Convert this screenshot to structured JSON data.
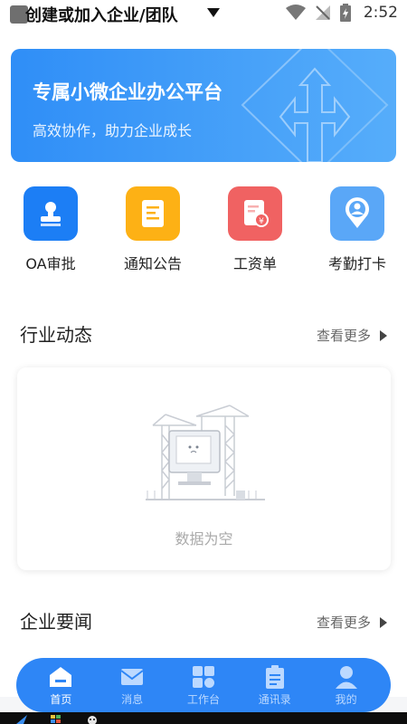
{
  "status_bar": {
    "title": "创建或加入企业/团队",
    "time": "2:52"
  },
  "banner": {
    "title": "专属小微企业办公平台",
    "subtitle": "高效协作，助力企业成长"
  },
  "quick_actions": [
    {
      "label": "OA审批",
      "icon": "stamp-icon",
      "color": "#1c7ef5"
    },
    {
      "label": "通知公告",
      "icon": "document-icon",
      "color": "#fdb115"
    },
    {
      "label": "工资单",
      "icon": "payslip-icon",
      "color": "#f06262"
    },
    {
      "label": "考勤打卡",
      "icon": "location-pin-icon",
      "color": "#5aa7f7"
    }
  ],
  "industry_news": {
    "title": "行业动态",
    "more_label": "查看更多",
    "empty_text": "数据为空"
  },
  "company_news": {
    "title": "企业要闻",
    "more_label": "查看更多"
  },
  "tabbar": {
    "tabs": [
      {
        "label": "首页",
        "icon": "home-icon",
        "active": true
      },
      {
        "label": "消息",
        "icon": "mail-icon",
        "active": false
      },
      {
        "label": "工作台",
        "icon": "grid-icon",
        "active": false
      },
      {
        "label": "通讯录",
        "icon": "clipboard-icon",
        "active": false
      },
      {
        "label": "我的",
        "icon": "user-icon",
        "active": false
      }
    ]
  },
  "colors": {
    "primary": "#2e86f6",
    "banner_start": "#2f8ef7",
    "banner_end": "#56adfa"
  }
}
